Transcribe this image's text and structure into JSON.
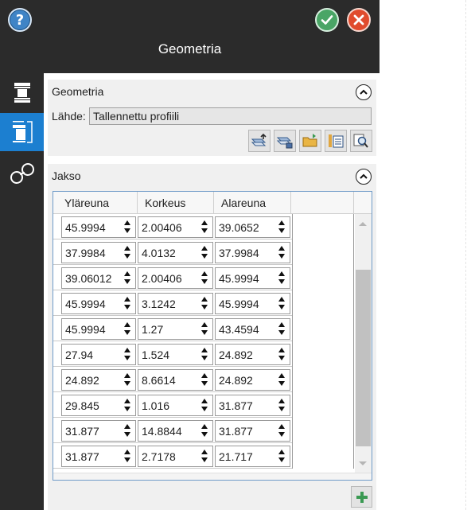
{
  "header": {
    "title": "Geometria",
    "help_glyph": "?",
    "help_icon": "help-icon",
    "ok_icon": "checkmark-icon",
    "cancel_icon": "close-icon"
  },
  "sidenav": {
    "items": [
      {
        "icon": "column-icon",
        "active": false
      },
      {
        "icon": "section-profile-icon",
        "active": true
      },
      {
        "icon": "connection-icon",
        "active": false
      }
    ],
    "accent": "#1c7fd0"
  },
  "geometry_panel": {
    "title": "Geometria",
    "source_label": "Lähde:",
    "source_value": "Tallennettu profiili",
    "tools": [
      "save-profile-icon",
      "load-profile-icon",
      "open-folder-icon",
      "table-properties-icon",
      "preview-search-icon"
    ]
  },
  "section_panel": {
    "title": "Jakso",
    "columns": [
      "Yläreuna",
      "Korkeus",
      "Alareuna",
      ""
    ],
    "rows": [
      [
        "45.9994",
        "2.00406",
        "39.0652"
      ],
      [
        "37.9984",
        "4.0132",
        "37.9984"
      ],
      [
        "39.06012",
        "2.00406",
        "45.9994"
      ],
      [
        "45.9994",
        "3.1242",
        "45.9994"
      ],
      [
        "45.9994",
        "1.27",
        "43.4594"
      ],
      [
        "27.94",
        "1.524",
        "24.892"
      ],
      [
        "24.892",
        "8.6614",
        "24.892"
      ],
      [
        "29.845",
        "1.016",
        "31.877"
      ],
      [
        "31.877",
        "14.8844",
        "31.877"
      ],
      [
        "31.877",
        "2.7178",
        "21.717"
      ]
    ],
    "add_icon": "plus-icon"
  },
  "colors": {
    "header_bg": "#2b2b2b",
    "ok": "#4aa566",
    "cancel": "#e04b2d",
    "help": "#3f84c6",
    "add": "#3b9a53"
  }
}
